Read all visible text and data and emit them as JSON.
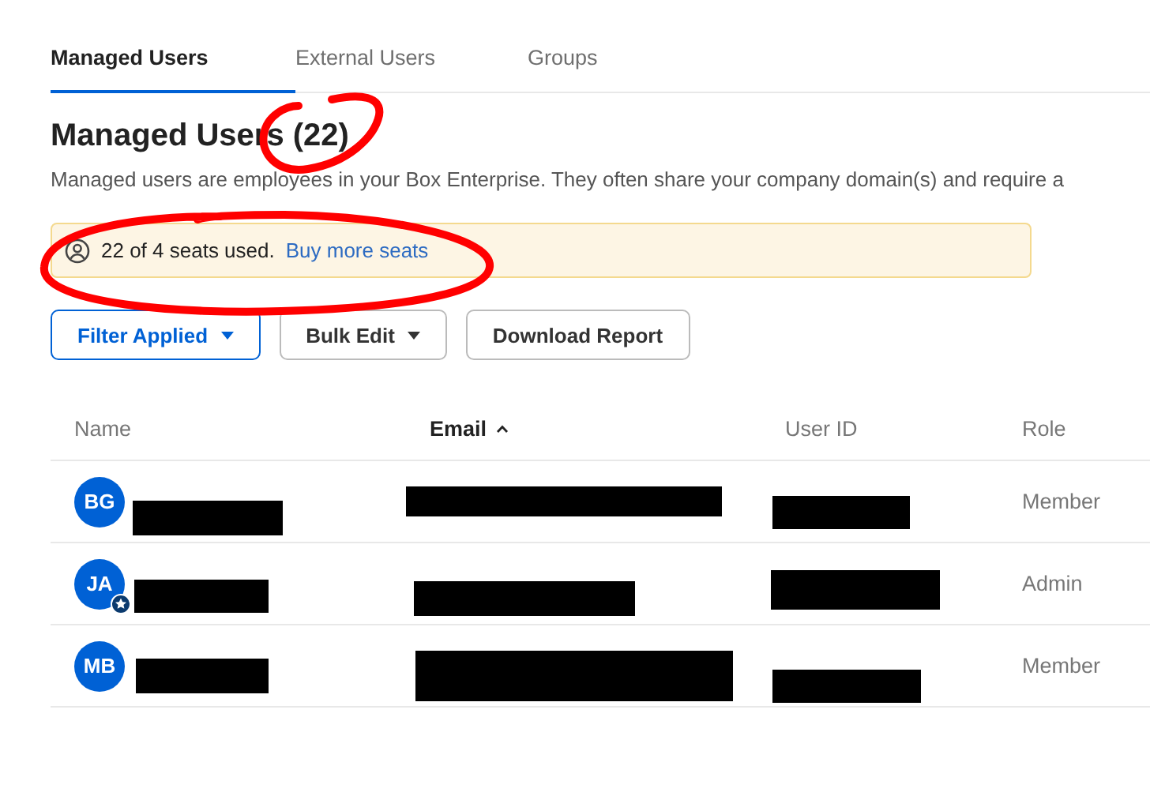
{
  "tabs": [
    {
      "label": "Managed Users",
      "selected": true
    },
    {
      "label": "External Users",
      "selected": false
    },
    {
      "label": "Groups",
      "selected": false
    }
  ],
  "heading": "Managed Users (22)",
  "description": "Managed users are employees in your Box Enterprise. They often share your company domain(s) and require a",
  "notice": {
    "text": "22 of 4 seats used.",
    "link": "Buy more seats"
  },
  "buttons": [
    {
      "label": "Filter Applied",
      "kind": "primary-menu"
    },
    {
      "label": "Bulk Edit",
      "kind": "menu"
    },
    {
      "label": "Download Report",
      "kind": "plain"
    }
  ],
  "table": {
    "columns": [
      {
        "label": "Name",
        "sorted": false
      },
      {
        "label": "Email",
        "sorted": true
      },
      {
        "label": "User ID",
        "sorted": false
      },
      {
        "label": "Role",
        "sorted": false
      }
    ],
    "rows": [
      {
        "initials": "BG",
        "admin": false,
        "role": "Member"
      },
      {
        "initials": "JA",
        "admin": true,
        "role": "Admin"
      },
      {
        "initials": "MB",
        "admin": false,
        "role": "Member"
      }
    ]
  }
}
